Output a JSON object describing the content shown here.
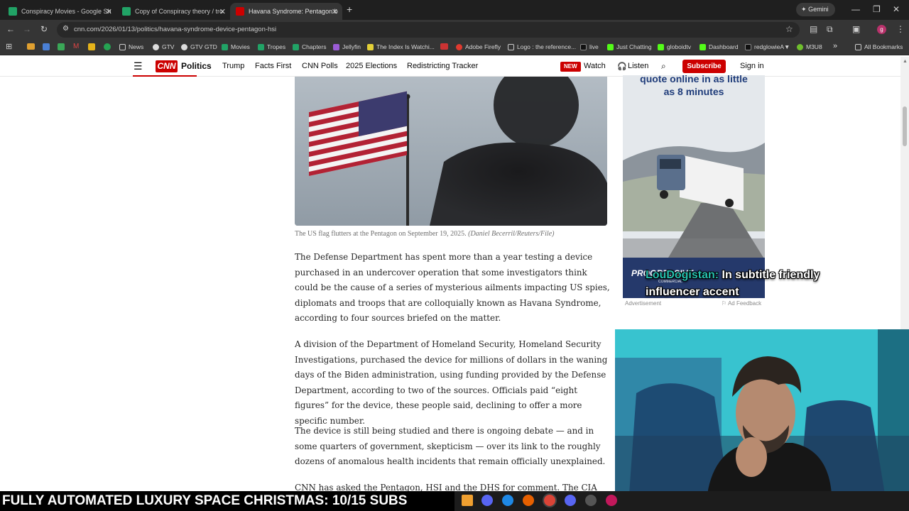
{
  "browser": {
    "tabs": [
      {
        "label": "Conspiracy Movies - Google Sh",
        "icon": "sheets-icon",
        "active": false
      },
      {
        "label": "Copy of Conspiracy theory / tro",
        "icon": "sheets-icon",
        "active": false
      },
      {
        "label": "Havana Syndrome: Pentagon b",
        "icon": "cnn-icon",
        "active": true
      }
    ],
    "new_tab": "+",
    "gemini_label": "Gemini",
    "url": "cnn.com/2026/01/13/politics/havana-syndrome-device-pentagon-hsi",
    "profile_initial": "g",
    "bookmarks": [
      "News",
      "GTV",
      "GTV GTD",
      "Movies",
      "Tropes",
      "Chapters",
      "Jellyfin",
      "The Index Is Watchi...",
      "Adobe Firefly",
      "Logo : the reference...",
      "live",
      "Just Chatting",
      "globoidtv",
      "Dashboard",
      "redglowieA▼",
      "M3U8"
    ],
    "all_bookmarks": "All Bookmarks",
    "more_bookmarks": "»"
  },
  "cnn": {
    "logo": "CNN",
    "section": "Politics",
    "nav_items": [
      "Trump",
      "Facts First",
      "CNN Polls",
      "2025 Elections",
      "Redistricting Tracker"
    ],
    "new_badge": "NEW",
    "watch": "Watch",
    "listen": "Listen",
    "subscribe": "Subscribe",
    "sign_in": "Sign in"
  },
  "article": {
    "caption": "The US flag flutters at the Pentagon on September 19, 2025.",
    "caption_credit": "(Daniel Becerril/Reuters/File)",
    "paragraphs": [
      "The Defense Department has spent more than a year testing a device purchased in an undercover operation that some investigators think could be the cause of a series of mysterious ailments impacting US spies, diplomats and troops that are colloquially known as Havana Syndrome, according to four sources briefed on the matter.",
      "A division of the Department of Homeland Security, Homeland Security Investigations, purchased the device for millions of dollars in the waning days of the Biden administration, using funding provided by the Defense Department, according to two of the sources. Officials paid “eight figures” for the device, these people said, declining to offer a more specific number.",
      "The device is still being studied and there is ongoing debate — and in some quarters of government, skepticism — over its link to the roughly dozens of anomalous health incidents that remain officially unexplained.",
      "CNN has asked the Pentagon, HSI and the DHS for comment. The CIA"
    ]
  },
  "ad": {
    "headline": "quote online in as little as 8 minutes",
    "brand": "PROGRESSIVE",
    "brand_sub": "COMMERCIAL",
    "label": "Advertisement",
    "feedback": "Ad Feedback"
  },
  "overlay": {
    "subtitle_speaker": "LouDogistan:",
    "subtitle_text": " In subtitle friendly influencer accent",
    "ticker": "FULLY AUTOMATED LUXURY SPACE CHRISTMAS: 10/15 SUBS"
  },
  "colors": {
    "cnn_red": "#cc0000",
    "browser_dark": "#1f1f1f",
    "toolbar": "#353535",
    "subtitle_speaker": "#27c0b0"
  }
}
